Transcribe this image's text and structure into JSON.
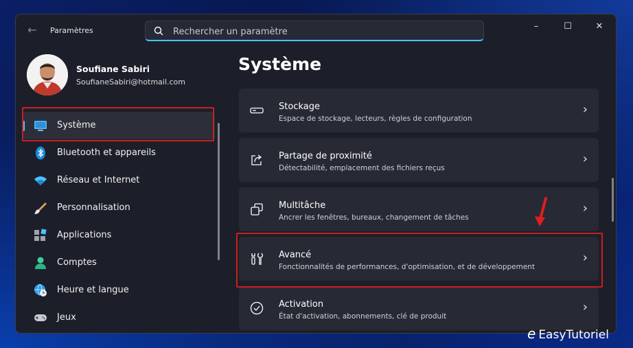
{
  "window": {
    "title": "Paramètres"
  },
  "search": {
    "placeholder": "Rechercher un paramètre"
  },
  "user": {
    "name": "Soufiane Sabiri",
    "email": "SoufianeSabiri@hotmail.com"
  },
  "page": {
    "title": "Système"
  },
  "sidebar": {
    "items": [
      {
        "label": "Système",
        "icon": "monitor-icon",
        "active": true
      },
      {
        "label": "Bluetooth et appareils",
        "icon": "bluetooth-icon"
      },
      {
        "label": "Réseau et Internet",
        "icon": "wifi-icon"
      },
      {
        "label": "Personnalisation",
        "icon": "brush-icon"
      },
      {
        "label": "Applications",
        "icon": "apps-icon"
      },
      {
        "label": "Comptes",
        "icon": "person-icon"
      },
      {
        "label": "Heure et langue",
        "icon": "globe-clock-icon"
      },
      {
        "label": "Jeux",
        "icon": "gamepad-icon"
      }
    ]
  },
  "cards": [
    {
      "title": "Stockage",
      "desc": "Espace de stockage, lecteurs, règles de configuration",
      "icon": "storage-icon"
    },
    {
      "title": "Partage de proximité",
      "desc": "Détectabilité, emplacement des fichiers reçus",
      "icon": "share-icon"
    },
    {
      "title": "Multitâche",
      "desc": "Ancrer les fenêtres, bureaux, changement de tâches",
      "icon": "multitask-icon"
    },
    {
      "title": "Avancé",
      "desc": "Fonctionnalités de performances, d'optimisation, et de développement",
      "icon": "tools-icon"
    },
    {
      "title": "Activation",
      "desc": "État d'activation, abonnements, clé de produit",
      "icon": "check-circle-icon"
    }
  ],
  "watermark": {
    "mark": "e",
    "text": "EasyTutoriel"
  },
  "colors": {
    "accent": "#4cc2ff",
    "highlight": "#cc1e1e"
  }
}
